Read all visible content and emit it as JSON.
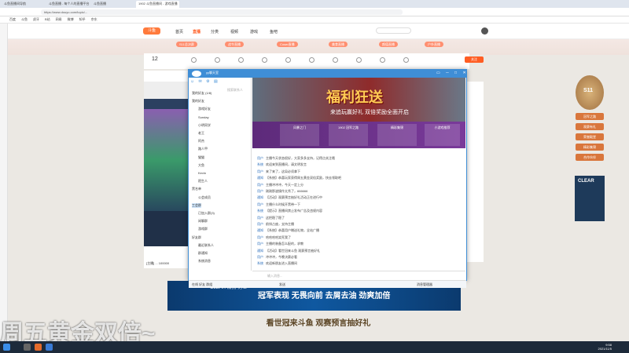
{
  "browser": {
    "tabs": [
      "斗鱼直播间导航",
      "斗鱼直播 - 每个人的直播平台",
      "斗鱼直播",
      "1902 斗鱼直播间 - 游戏直播"
    ],
    "url": "https://www.douyu.com/topic/...",
    "bookmarks": [
      "百度",
      "斗鱼",
      "虎牙",
      "B站",
      "网易",
      "微博",
      "知乎",
      "京东"
    ]
  },
  "site": {
    "logo": "斗鱼",
    "nav": [
      "首页",
      "直播",
      "分类",
      "视频",
      "游戏",
      "鱼吧"
    ],
    "active_nav": "直播",
    "banner_pills": [
      "S11总决赛",
      "战令直播",
      "Coser直播",
      "美食直播",
      "颜值直播",
      "户外直播"
    ]
  },
  "room": {
    "viewer_count": "12",
    "follow_label": "关注",
    "below_text": "[主播] ... 100000"
  },
  "promo": {
    "medal_text": "S11",
    "buttons": [
      "冠军之路",
      "观赛有礼",
      "荣誉殿堂",
      "精彩集锦",
      "合作伙伴"
    ],
    "right_ad_brand": "CLEAR",
    "bottom_ad_brand": "CLEAR 清扬 男士",
    "bottom_ad_text": "冠军表现 无畏向前 去屑去油 劲爽加倍",
    "slogan": "看世冠来斗鱼  观赛预言抽好礼",
    "overlay_text": "周五黄金双倍~"
  },
  "chat": {
    "window_title": "yy聊天室",
    "controls": "▭ ─ □ ✕",
    "toolbar": "☺ ✉ ⚙ ▤",
    "search_placeholder": "搜索联系人",
    "tree": [
      "我的好友 (1/8)",
      "我的好友",
      "游戏好友",
      "Sunday",
      "小明同学",
      "老王",
      "阿杰",
      "路人甲",
      "猫猫",
      "大鱼",
      "Kevin",
      "陌生人",
      "黑名单",
      "公会成员",
      "工会群",
      "已加入群(3)",
      "闲聊群",
      "游戏群",
      "好友群",
      "最近联系人",
      "群通知",
      "系统消息"
    ],
    "selected_index": 14,
    "ad_title": "福利狂送",
    "ad_sub": "来追玩赢好礼 双倍奖励全面开启",
    "ad_cards": [
      "风暴之门",
      "1902 冠军之路",
      "精彩集锦",
      "小游戏推荐"
    ],
    "messages": [
      {
        "name": "用户",
        "text": "主播今天状态很好，大家多多支持，记得点关注哦"
      },
      {
        "name": "系统",
        "text": "欢迎来到直播间，请文明发言"
      },
      {
        "name": "用户",
        "text": "来了来了，这局必须拿下"
      },
      {
        "name": "通知",
        "text": "【系统】恭喜玩家获得周五黄金双倍奖励，快去领取吧"
      },
      {
        "name": "用户",
        "text": "主播冲冲冲，今天一定上分"
      },
      {
        "name": "用户",
        "text": "刚刚那波操作太秀了，666666"
      },
      {
        "name": "通知",
        "text": "【活动】观赛预言抽好礼活动正在进行中"
      },
      {
        "name": "用户",
        "text": "主播什么时候开黑带一下"
      },
      {
        "name": "系统",
        "text": "【提示】直播间禁止发布广告及违规内容"
      },
      {
        "name": "用户",
        "text": "这把稳了稳了"
      },
      {
        "name": "用户",
        "text": "前排占座，支持主播"
      },
      {
        "name": "通知",
        "text": "【系统】恭喜用户赠送礼物，全站广播"
      },
      {
        "name": "用户",
        "text": "哈哈哈哈笑死我了"
      },
      {
        "name": "用户",
        "text": "主播的装备怎么配的，求教"
      },
      {
        "name": "通知",
        "text": "【活动】看世冠来斗鱼 观赛预言抽好礼"
      },
      {
        "name": "用户",
        "text": "冲冲冲，今晚决赛必看"
      },
      {
        "name": "系统",
        "text": "欢迎新朋友进入直播间"
      }
    ],
    "input_placeholder": "输入消息...",
    "bottom_left": "在线  好友  群组",
    "bottom_mid": "发送",
    "bottom_right": "消息管理器"
  },
  "taskbar": {
    "time": "9:58",
    "date": "2021/11/5"
  },
  "colors": {
    "accent": "#ff5d23",
    "chat_blue": "#3f8ed6"
  }
}
